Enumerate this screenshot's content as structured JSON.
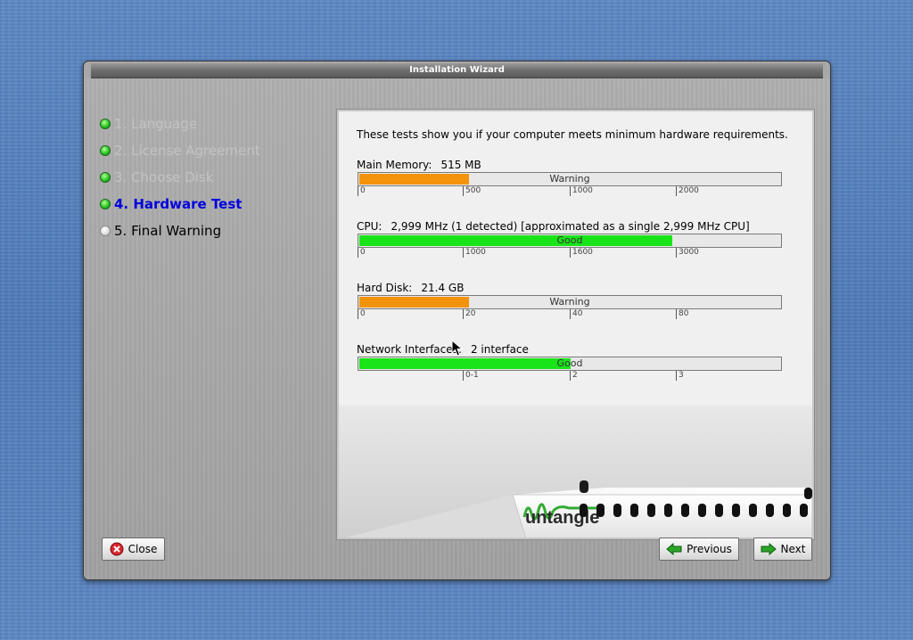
{
  "window": {
    "title": "Installation Wizard"
  },
  "steps": [
    {
      "label": "1. Language",
      "state": "done"
    },
    {
      "label": "2. License Agreement",
      "state": "done"
    },
    {
      "label": "3. Choose Disk",
      "state": "done"
    },
    {
      "label": "4. Hardware Test",
      "state": "current"
    },
    {
      "label": "5. Final Warning",
      "state": "todo"
    }
  ],
  "intro": "These tests show you if your computer meets minimum hardware requirements.",
  "tests": [
    {
      "label": "Main Memory:",
      "value": "515 MB",
      "status": "Warning",
      "fill_percent": 26,
      "color": "#f3930c",
      "ticks": [
        "0",
        "500",
        "1000",
        "2000"
      ]
    },
    {
      "label": "CPU:",
      "value": "2,999 MHz (1 detected) [approximated as a single 2,999 MHz CPU]",
      "status": "Good",
      "fill_percent": 74,
      "color": "#19e418",
      "ticks": [
        "0",
        "1000",
        "1600",
        "3000"
      ]
    },
    {
      "label": "Hard Disk:",
      "value": "21.4 GB",
      "status": "Warning",
      "fill_percent": 26,
      "color": "#f3930c",
      "ticks": [
        "0",
        "20",
        "40",
        "80"
      ]
    },
    {
      "label": "Network Interfaces:",
      "value": "2 interface",
      "status": "Good",
      "fill_percent": 50,
      "color": "#19e418",
      "ticks": [
        "",
        "0-1",
        "2",
        "3"
      ]
    }
  ],
  "brand": {
    "logo_text": "untangle"
  },
  "buttons": {
    "close": {
      "label": "Close",
      "icon": "close-icon"
    },
    "previous": {
      "label": "Previous",
      "icon": "arrow-left-icon"
    },
    "next": {
      "label": "Next",
      "icon": "arrow-right-icon"
    }
  },
  "colors": {
    "current_step": "#0000dd",
    "completed_step": "#c3c3c3",
    "warning": "#f3930c",
    "good": "#19e418"
  }
}
